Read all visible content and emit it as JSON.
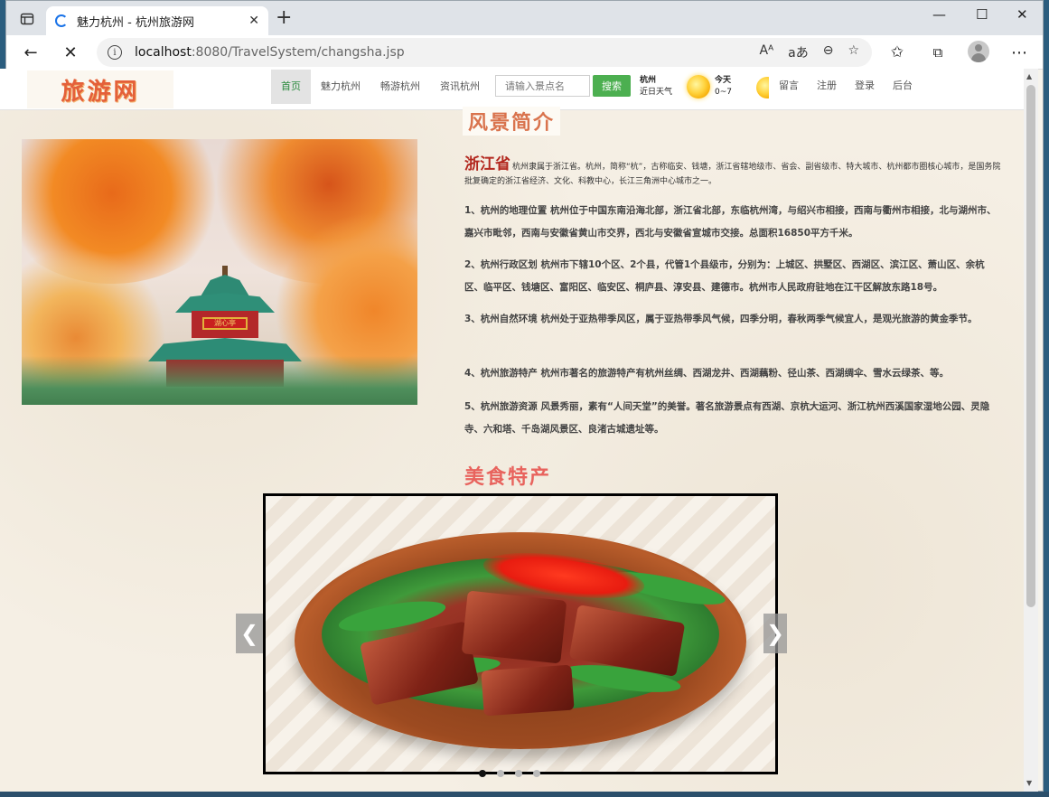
{
  "browser": {
    "tab_title": "魅力杭州 - 杭州旅游网",
    "url_host": "localhost",
    "url_path": ":8080/TravelSystem/changsha.jsp",
    "read_aloud_icon": "Aᴬ",
    "reader_icon": "aあ"
  },
  "site": {
    "logo": "旅游网",
    "nav": {
      "home": "首页",
      "charm": "魅力杭州",
      "tour": "畅游杭州",
      "news": "资讯杭州"
    },
    "search": {
      "placeholder": "请输入景点名",
      "button": "搜索"
    },
    "weather": {
      "city": "杭州",
      "subtitle": "近日天气",
      "today_label": "今天",
      "today_temp": "0~7"
    },
    "links": {
      "message": "留言",
      "register": "注册",
      "login": "登录",
      "admin": "后台"
    }
  },
  "scenery": {
    "title": "风景简介",
    "province": "浙江省",
    "intro": "杭州隶属于浙江省。杭州，简称“杭”，古称临安、钱塘，浙江省辖地级市、省会、副省级市、特大城市、杭州都市圈核心城市，是国务院批复确定的浙江省经济、文化、科教中心，长江三角洲中心城市之一。",
    "paragraphs": [
      "1、杭州的地理位置 杭州位于中国东南沿海北部，浙江省北部，东临杭州湾，与绍兴市相接，西南与衢州市相接，北与湖州市、嘉兴市毗邻，西南与安徽省黄山市交界，西北与安徽省宣城市交接。总面积16850平方千米。",
      "2、杭州行政区划 杭州市下辖10个区、2个县，代管1个县级市，分别为：上城区、拱墅区、西湖区、滨江区、萧山区、余杭区、临平区、钱塘区、富阳区、临安区、桐庐县、淳安县、建德市。杭州市人民政府驻地在江干区解放东路18号。",
      "3、杭州自然环境 杭州处于亚热带季风区，属于亚热带季风气候，四季分明，春秋两季气候宜人，是观光旅游的黄金季节。",
      "4、杭州旅游特产 杭州市著名的旅游特产有杭州丝绸、西湖龙井、西湖藕粉、径山茶、西湖绸伞、雪水云绿茶、等。",
      "5、杭州旅游资源 风景秀丽，素有“人间天堂”的美誉。著名旅游景点有西湖、京杭大运河、浙江杭州西溪国家湿地公园、灵隐寺、六和塔、千岛湖风景区、良渚古城遗址等。"
    ],
    "pavilion_sign": "湖心亭"
  },
  "food": {
    "title": "美食特产",
    "prev": "❮",
    "next": "❯",
    "slide_count": 4,
    "active_slide": 1
  },
  "colors": {
    "accent_green": "#4caf50",
    "title_orange": "#d9734d",
    "title_red": "#e8635d",
    "province_red": "#b3281f"
  }
}
